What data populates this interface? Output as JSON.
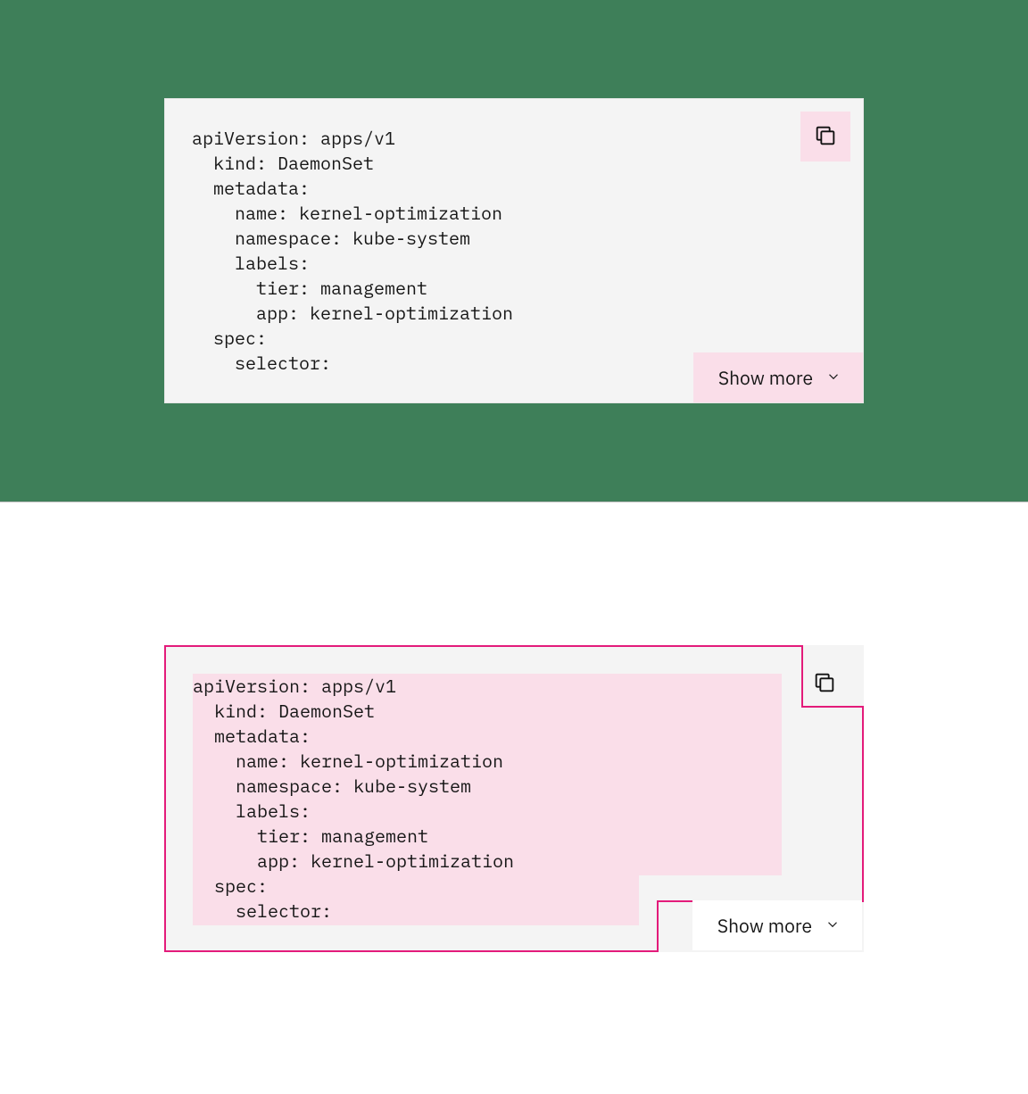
{
  "code_lines": [
    "apiVersion: apps/v1",
    "  kind: DaemonSet",
    "  metadata:",
    "    name: kernel-optimization",
    "    namespace: kube-system",
    "    labels:",
    "      tier: management",
    "      app: kernel-optimization",
    "  spec:",
    "    selector:"
  ],
  "show_more_label": "Show more",
  "copy_icon_name": "copy-icon",
  "chevron_icon_name": "chevron-down-icon"
}
